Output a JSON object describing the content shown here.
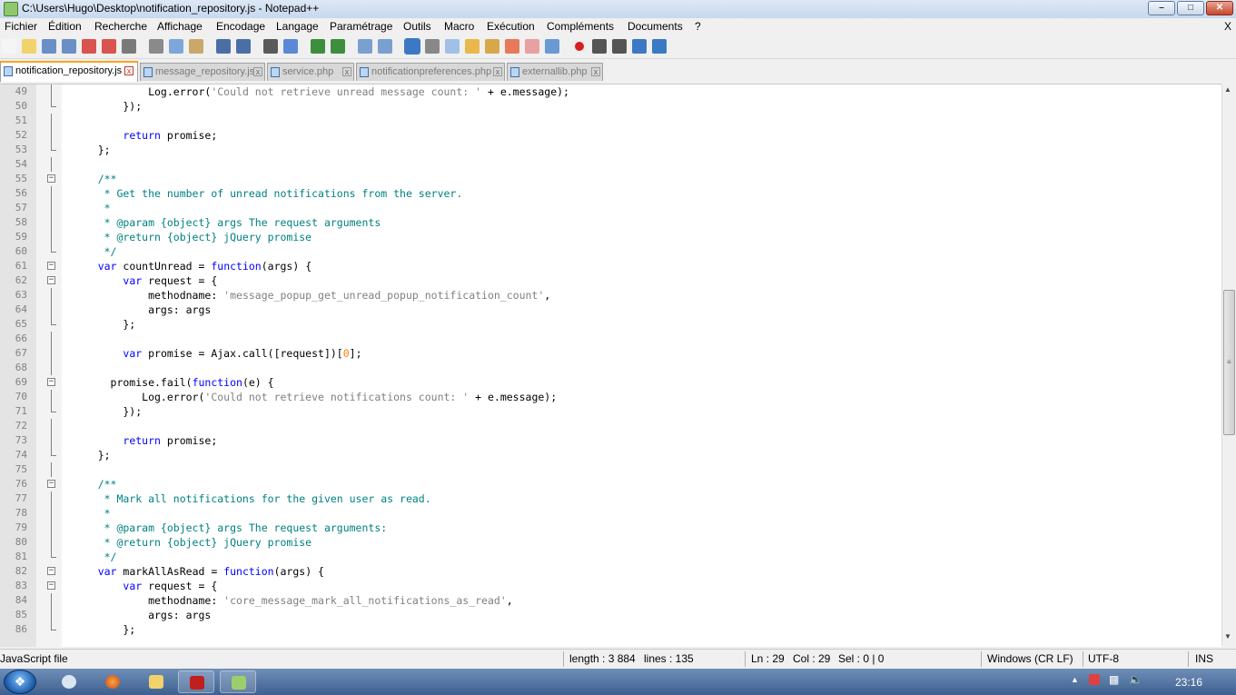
{
  "window": {
    "title": "C:\\Users\\Hugo\\Desktop\\notification_repository.js - Notepad++",
    "controls": [
      "–",
      "□",
      "✕"
    ]
  },
  "menu": [
    "Fichier",
    "Édition",
    "Recherche",
    "Affichage",
    "Encodage",
    "Langage",
    "Paramétrage",
    "Outils",
    "Macro",
    "Exécution",
    "Compléments",
    "Documents",
    "?"
  ],
  "menu_close": "X",
  "toolbar_icons": [
    "new-file-icon",
    "open-file-icon",
    "save-icon",
    "save-all-icon",
    "close-icon",
    "close-all-icon",
    "print-icon",
    "cut-icon",
    "copy-icon",
    "paste-icon",
    "undo-icon",
    "redo-icon",
    "find-icon",
    "replace-icon",
    "zoom-in-icon",
    "zoom-out-icon",
    "sync-vertical-icon",
    "sync-horizontal-icon",
    "word-wrap-icon",
    "show-all-chars-icon",
    "indent-guide-icon",
    "user-lang-icon",
    "doc-map-icon",
    "function-list-icon",
    "folder-workspace-icon",
    "monitoring-icon",
    "record-macro-icon",
    "stop-macro-icon",
    "play-macro-icon",
    "run-macro-multiple-icon",
    "save-macro-icon"
  ],
  "tabs": [
    {
      "label": "notification_repository.js",
      "active": true
    },
    {
      "label": "message_repository.js",
      "active": false
    },
    {
      "label": "service.php",
      "active": false
    },
    {
      "label": "notificationpreferences.php",
      "active": false
    },
    {
      "label": "externallib.php",
      "active": false
    }
  ],
  "tab_close": "x",
  "code_lines": [
    {
      "n": "49",
      "text": "            Log.error('Could not retrieve unread message count: ' + e.message);"
    },
    {
      "n": "50",
      "text": "        });"
    },
    {
      "n": "51",
      "text": ""
    },
    {
      "n": "52",
      "text": "        return promise;"
    },
    {
      "n": "53",
      "text": "    };"
    },
    {
      "n": "54",
      "text": ""
    },
    {
      "n": "55",
      "text": "    /**"
    },
    {
      "n": "56",
      "text": "     * Get the number of unread notifications from the server."
    },
    {
      "n": "57",
      "text": "     *"
    },
    {
      "n": "58",
      "text": "     * @param {object} args The request arguments"
    },
    {
      "n": "59",
      "text": "     * @return {object} jQuery promise"
    },
    {
      "n": "60",
      "text": "     */"
    },
    {
      "n": "61",
      "text": "    var countUnread = function(args) {"
    },
    {
      "n": "62",
      "text": "        var request = {"
    },
    {
      "n": "63",
      "text": "            methodname: 'message_popup_get_unread_popup_notification_count',"
    },
    {
      "n": "64",
      "text": "            args: args"
    },
    {
      "n": "65",
      "text": "        };"
    },
    {
      "n": "66",
      "text": ""
    },
    {
      "n": "67",
      "text": "        var promise = Ajax.call([request])[0];"
    },
    {
      "n": "68",
      "text": ""
    },
    {
      "n": "69",
      "text": "      promise.fail(function(e) {"
    },
    {
      "n": "70",
      "text": "           Log.error('Could not retrieve notifications count: ' + e.message);"
    },
    {
      "n": "71",
      "text": "        });"
    },
    {
      "n": "72",
      "text": ""
    },
    {
      "n": "73",
      "text": "        return promise;"
    },
    {
      "n": "74",
      "text": "    };"
    },
    {
      "n": "75",
      "text": ""
    },
    {
      "n": "76",
      "text": "    /**"
    },
    {
      "n": "77",
      "text": "     * Mark all notifications for the given user as read."
    },
    {
      "n": "78",
      "text": "     *"
    },
    {
      "n": "79",
      "text": "     * @param {object} args The request arguments:"
    },
    {
      "n": "80",
      "text": "     * @return {object} jQuery promise"
    },
    {
      "n": "81",
      "text": "     */"
    },
    {
      "n": "82",
      "text": "    var markAllAsRead = function(args) {"
    },
    {
      "n": "83",
      "text": "        var request = {"
    },
    {
      "n": "84",
      "text": "            methodname: 'core_message_mark_all_notifications_as_read',"
    },
    {
      "n": "85",
      "text": "            args: args"
    },
    {
      "n": "86",
      "text": "        };"
    }
  ],
  "status": {
    "file_type": "JavaScript file",
    "length": "length : 3 884",
    "lines": "lines : 135",
    "ln": "Ln : 29",
    "col": "Col : 29",
    "sel": "Sel : 0 | 0",
    "eol": "Windows (CR LF)",
    "encoding": "UTF-8",
    "mode": "INS"
  },
  "taskbar": {
    "apps": [
      "windows-explorer-icon",
      "ie-icon",
      "firefox-icon",
      "folder-icon",
      "filezilla-icon",
      "notepadpp-icon"
    ],
    "clock": "23:16"
  },
  "colors": {
    "keyword": "#0000ff",
    "comment": "#008080",
    "string": "#808080",
    "number": "#ff8000"
  }
}
